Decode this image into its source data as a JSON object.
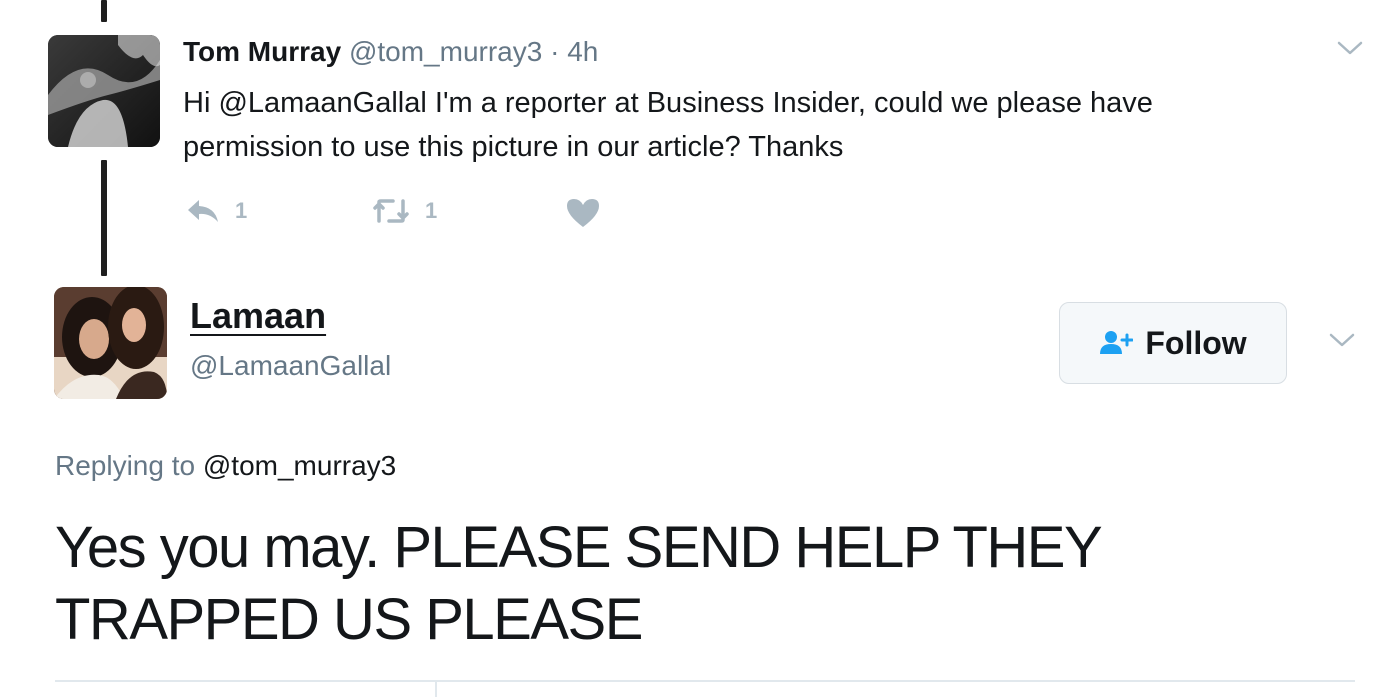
{
  "parent_tweet": {
    "author_name": "Tom Murray",
    "author_handle": "@tom_murray3",
    "separator": "·",
    "time": "4h",
    "text_line1": "Hi @LamaanGallal I'm a reporter at Business Insider, could we please have",
    "text_line2": "permission to use this picture in our article? Thanks",
    "reply_count": "1",
    "retweet_count": "1",
    "avatar_icon": "profile-photo",
    "action_color": "#aab8c2"
  },
  "main_tweet": {
    "author_name": "Lamaan",
    "author_handle": "@LamaanGallal",
    "follow_label": "Follow",
    "replying_prefix": "Replying to",
    "replying_to": "@tom_murray3",
    "text_line1": "Yes you may. PLEASE SEND HELP THEY",
    "text_line2": "TRAPPED US PLEASE",
    "follow_icon_color": "#1da1f2"
  },
  "colors": {
    "secondary_text": "#657786",
    "primary_text": "#14171a",
    "icon_gray": "#aab8c2",
    "brand_blue": "#1da1f2"
  }
}
